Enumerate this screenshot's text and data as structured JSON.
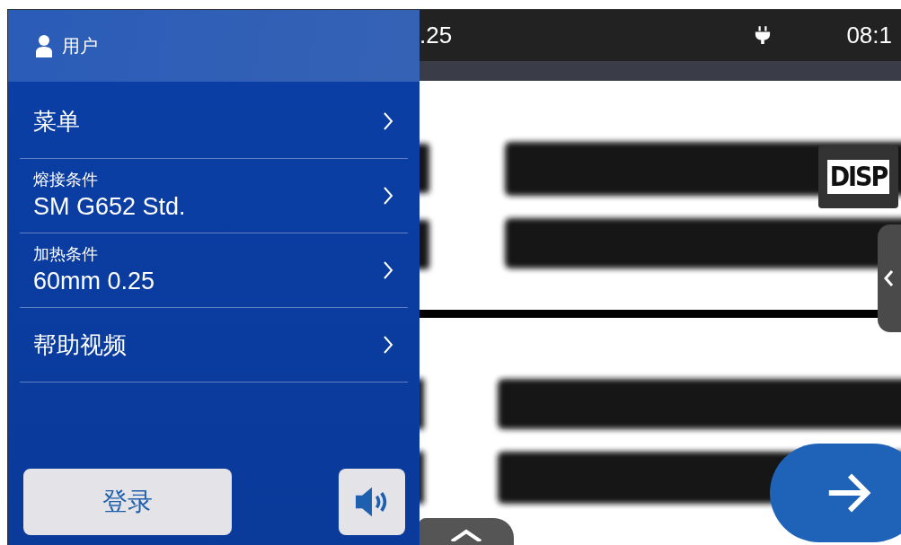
{
  "status_bar": {
    "reading": ".25",
    "time": "08:1"
  },
  "side_menu": {
    "title": "用户",
    "items": [
      {
        "label": "菜单"
      },
      {
        "label": "熔接条件",
        "value": "SM G652 Std."
      },
      {
        "label": "加热条件",
        "value": "60mm 0.25"
      },
      {
        "label": "帮助视频"
      }
    ],
    "login_button": "登录"
  },
  "camera_view": {
    "disp_button": "DISP"
  }
}
